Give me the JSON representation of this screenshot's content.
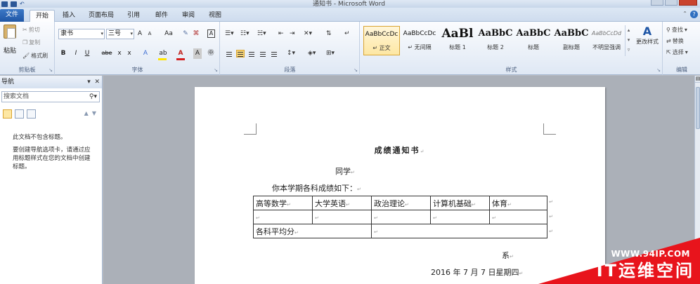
{
  "window": {
    "title": "通知书 - Microsoft Word"
  },
  "tabs": [
    {
      "label": "文件"
    },
    {
      "label": "开始"
    },
    {
      "label": "插入"
    },
    {
      "label": "页面布局"
    },
    {
      "label": "引用"
    },
    {
      "label": "邮件"
    },
    {
      "label": "审阅"
    },
    {
      "label": "视图"
    }
  ],
  "ribbon": {
    "clipboard": {
      "paste": "粘贴",
      "cut": "剪切",
      "copy": "复制",
      "format_painter": "格式刷",
      "label": "剪贴板"
    },
    "font": {
      "name": "隶书",
      "size": "三号",
      "grow": "A",
      "shrink": "A",
      "case": "Aa",
      "bold": "B",
      "italic": "I",
      "underline": "U",
      "strike": "abe",
      "sub": "x",
      "sup": "x",
      "label": "字体"
    },
    "paragraph": {
      "label": "段落"
    },
    "styles": {
      "items": [
        {
          "preview": "AaBbCcDc",
          "label": "↵ 正文"
        },
        {
          "preview": "AaBbCcDc",
          "label": "↵ 无间隔"
        },
        {
          "preview": "AaBl",
          "label": "标题 1"
        },
        {
          "preview": "AaBbC",
          "label": "标题 2"
        },
        {
          "preview": "AaBbC",
          "label": "标题"
        },
        {
          "preview": "AaBbC",
          "label": "副标题"
        },
        {
          "preview": "AaBbCcDd",
          "label": "不明显强调"
        }
      ],
      "change_styles": "更改样式",
      "label": "样式"
    },
    "editing": {
      "find": "查找",
      "replace": "替换",
      "select": "选择",
      "label": "编辑"
    }
  },
  "nav": {
    "title": "导航",
    "search_placeholder": "搜索文档",
    "message1": "此文档不包含标题。",
    "message2": "要创建导航选项卡，请通过应用标题样式在您的文档中创建标题。"
  },
  "document": {
    "title": "成绩通知书",
    "greeting": "同学",
    "intro": "你本学期各科成绩如下：",
    "subjects": [
      "高等数学",
      "大学英语",
      "政治理论",
      "计算机基础",
      "体育"
    ],
    "average_label": "各科平均分",
    "department": "系",
    "date": "2016 年 7 月 7 日星期四"
  },
  "watermark": {
    "site": "WWW.94IP.COM",
    "brand": "IT运维空间"
  }
}
